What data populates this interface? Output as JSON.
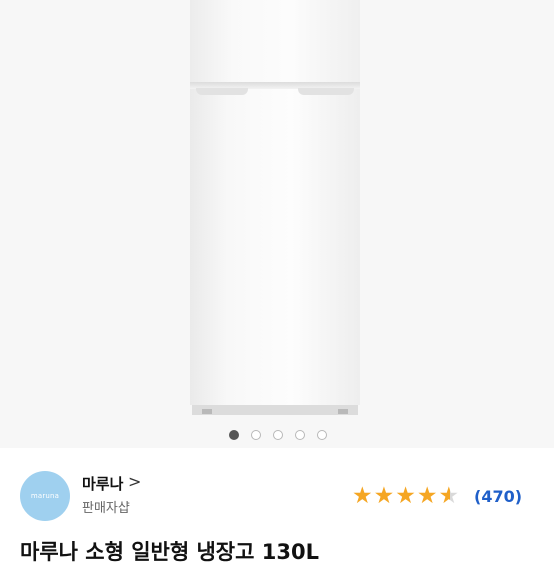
{
  "gallery": {
    "image_alt": "white two-door refrigerator",
    "dot_count": 5,
    "active_index": 0
  },
  "seller": {
    "logo_text": "maruna",
    "name": "마루나",
    "chevron": ">",
    "type": "판매자샵"
  },
  "rating": {
    "stars": 4.5,
    "review_count": "(470)",
    "star_color": "#f5a623",
    "link_color": "#1f5fc9"
  },
  "product": {
    "title": "마루나 소형 일반형 냉장고 130L"
  }
}
